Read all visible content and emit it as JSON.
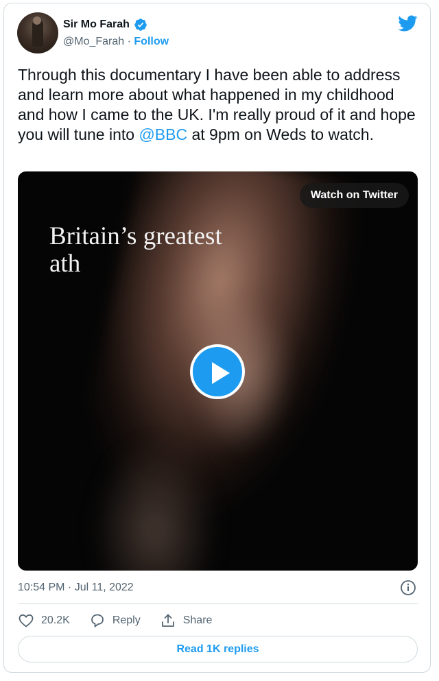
{
  "author": {
    "name": "Sir Mo Farah",
    "handle": "@Mo_Farah",
    "separator": "·",
    "follow_label": "Follow"
  },
  "tweet": {
    "text_before": "Through this documentary I have been able to address and learn more about what happened in my childhood and how I came to the UK. I'm really proud of it and hope you will tune into ",
    "mention": "@BBC",
    "text_after": " at 9pm on Weds to watch."
  },
  "media": {
    "overlay_line1": "Britain’s greatest",
    "overlay_line2": "ath",
    "watch_label": "Watch on Twitter"
  },
  "timestamp": "10:54 PM · Jul 11, 2022",
  "actions": {
    "like_count": "20.2K",
    "reply_label": "Reply",
    "share_label": "Share"
  },
  "replies_button": "Read 1K replies",
  "icons": [
    "verified-badge-icon",
    "twitter-bird-icon",
    "play-icon",
    "info-icon",
    "heart-icon",
    "reply-icon",
    "share-icon"
  ],
  "colors": {
    "accent": "#1d9bf0",
    "muted": "#536471",
    "border": "#cfd9de"
  }
}
